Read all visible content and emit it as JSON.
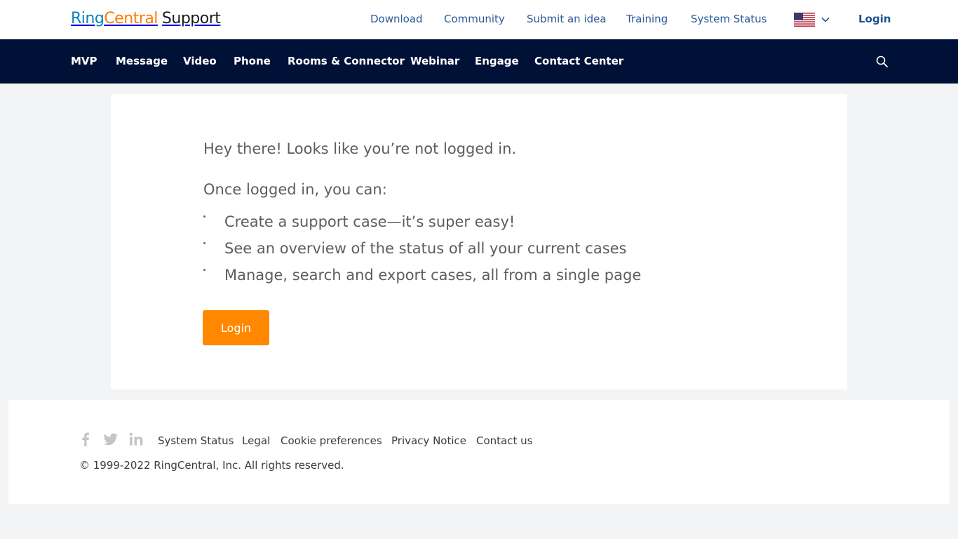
{
  "header": {
    "logo": {
      "ring": "Ring",
      "central": "Central",
      "support": "Support"
    },
    "nav": [
      "Download",
      "Community",
      "Submit an idea",
      "Training",
      "System Status"
    ],
    "locale_icon": "us-flag-icon",
    "login_label": "Login"
  },
  "main_nav": {
    "items": [
      "MVP",
      "Message",
      "Video",
      "Phone",
      "Rooms & Connector",
      "Webinar",
      "Engage",
      "Contact Center"
    ],
    "search_icon": "search-icon"
  },
  "card": {
    "greeting": "Hey there! Looks like you’re not logged in.",
    "intro": "Once logged in, you can:",
    "benefits": [
      "Create a support case—it’s super easy!",
      "See an overview of the status of all your current cases",
      "Manage, search and export cases, all from a single page"
    ],
    "login_button": "Login"
  },
  "footer": {
    "social": [
      "facebook-icon",
      "twitter-icon",
      "linkedin-icon"
    ],
    "links": [
      "System Status",
      "Legal",
      "Cookie preferences",
      "Privacy Notice",
      "Contact us"
    ],
    "copyright": "© 1999-2022 RingCentral, Inc. All rights reserved."
  },
  "colors": {
    "brand_blue": "#0684bc",
    "brand_orange": "#ff7a00",
    "nav_bg": "#001137",
    "button": "#ff8800",
    "link": "#2a5a9b"
  }
}
